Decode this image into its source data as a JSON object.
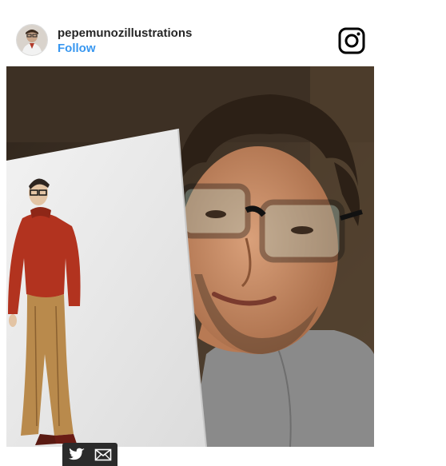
{
  "header": {
    "username": "pepemunozillustrations",
    "follow_label": "Follow"
  },
  "icons": {
    "brand": "instagram-icon",
    "share": [
      "twitter-icon",
      "mail-icon"
    ]
  },
  "colors": {
    "follow_blue": "#3897f0",
    "username_text": "#262626",
    "share_bar": "#2b2b2b"
  }
}
